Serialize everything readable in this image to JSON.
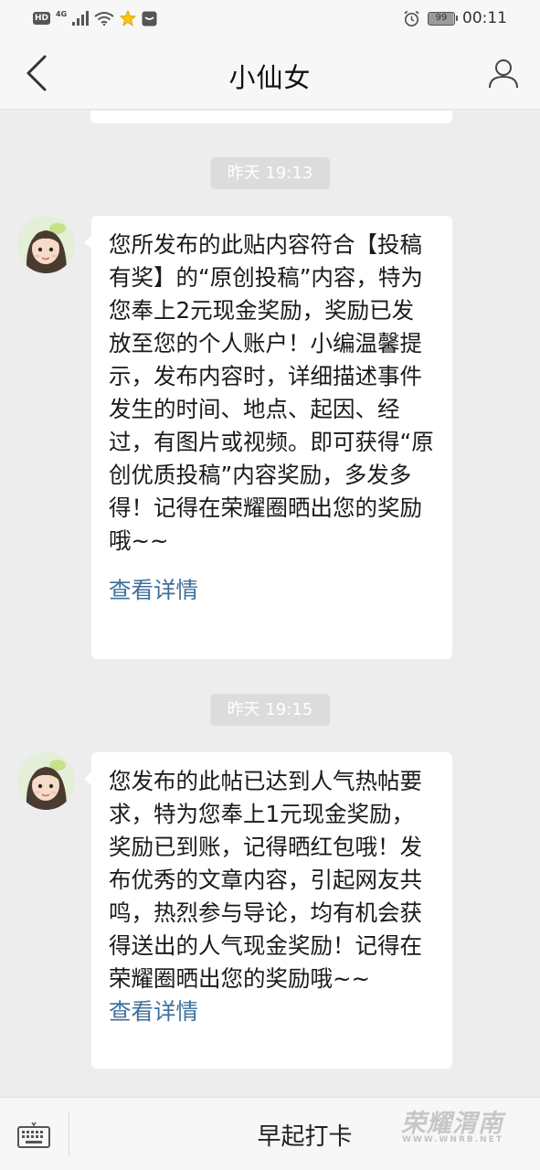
{
  "status_bar": {
    "hd_badge": "HD",
    "network": "4G",
    "battery": "99",
    "time": "00:11"
  },
  "header": {
    "title": "小仙女"
  },
  "messages": [
    {
      "timestamp": "昨天 19:13",
      "text": "您所发布的此贴内容符合【投稿有奖】的“原创投稿”内容，特为您奉上2元现金奖励，奖励已发放至您的个人账户！小编温馨提示，发布内容时，详细描述事件发生的时间、地点、起因、经过，有图片或视频。即可获得“原创优质投稿”内容奖励，多发多得！记得在荣耀圈晒出您的奖励哦~~",
      "link": "查看详情"
    },
    {
      "timestamp": "昨天 19:15",
      "text": "您发布的此帖已达到人气热帖要求，特为您奉上1元现金奖励，奖励已到账，记得晒红包哦！发布优秀的文章内容，引起网友共鸣，热烈参与导论，均有机会获得送出的人气现金奖励！记得在荣耀圈晒出您的奖励哦~~",
      "link": "查看详情"
    }
  ],
  "bottom_bar": {
    "menu_label": "早起打卡"
  },
  "watermark": {
    "text": "荣耀渭南",
    "subtext": "WWW.WNRB.NET"
  },
  "icons": {
    "back": "chevron-left-icon",
    "profile": "person-icon",
    "keyboard": "keyboard-icon"
  }
}
